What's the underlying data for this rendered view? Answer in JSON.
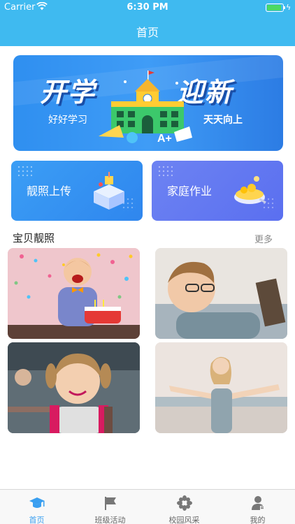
{
  "status": {
    "carrier": "Carrier",
    "time": "6:30 PM"
  },
  "nav": {
    "title": "首页"
  },
  "banner": {
    "left_big": "开学",
    "right_big": "迎新",
    "left_sub": "好好学习",
    "right_sub": "天天向上"
  },
  "features": [
    {
      "label": "靓照上传",
      "icon": "upload-box-icon"
    },
    {
      "label": "家庭作业",
      "icon": "homework-bowl-icon"
    }
  ],
  "section": {
    "title": "宝贝靓照",
    "more": "更多"
  },
  "photos": [
    {
      "subject": "birthday-boy-photo"
    },
    {
      "subject": "boy-reading-photo"
    },
    {
      "subject": "girl-backpack-photo"
    },
    {
      "subject": "girl-arms-open-photo"
    }
  ],
  "tabs": [
    {
      "label": "首页",
      "icon": "graduation-cap-icon",
      "active": true
    },
    {
      "label": "班级活动",
      "icon": "flag-icon",
      "active": false
    },
    {
      "label": "校园风采",
      "icon": "flower-icon",
      "active": false
    },
    {
      "label": "我的",
      "icon": "person-icon",
      "active": false
    }
  ],
  "colors": {
    "primary": "#3fbaf0",
    "tab_active": "#3a9ff0",
    "card_upload": "#3b9ef5",
    "card_homework": "#6d83f2"
  }
}
